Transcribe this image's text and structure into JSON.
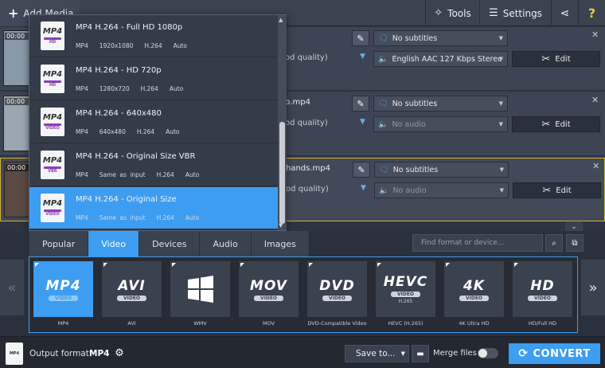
{
  "toolbar": {
    "add_media": "Add Media",
    "tools": "Tools",
    "settings": "Settings",
    "help": "?"
  },
  "files": [
    {
      "time": "00:00",
      "name": "",
      "quality": "od quality)",
      "subtitles": "No subtitles",
      "audio": "English AAC 127 Kbps Stereo",
      "audio_dim": false,
      "edit": "Edit"
    },
    {
      "time": "00:00",
      "name": "p.mp4",
      "quality": "od quality)",
      "subtitles": "No subtitles",
      "audio": "No audio",
      "audio_dim": true,
      "edit": "Edit"
    },
    {
      "time": "00:00",
      "name": "hands.mp4",
      "quality": "od quality)",
      "subtitles": "No subtitles",
      "audio": "No audio",
      "audio_dim": true,
      "edit": "Edit"
    }
  ],
  "dropdown": {
    "items": [
      {
        "title": "MP4 H.264 - Full HD 1080p",
        "container": "MP4",
        "size": "1920x1080",
        "codec": "H.264",
        "bitrate": "Auto",
        "tag": "HD"
      },
      {
        "title": "MP4 H.264 - HD 720p",
        "container": "MP4",
        "size": "1280x720",
        "codec": "H.264",
        "bitrate": "Auto",
        "tag": "HD"
      },
      {
        "title": "MP4 H.264 - 640x480",
        "container": "MP4",
        "size": "640x480",
        "codec": "H.264",
        "bitrate": "Auto",
        "tag": "VIDEO"
      },
      {
        "title": "MP4 H.264 - Original Size VBR",
        "container": "MP4",
        "size": "Same as input",
        "codec": "H.264",
        "bitrate": "Auto",
        "tag": "VBR"
      },
      {
        "title": "MP4 H.264 - Original Size",
        "container": "MP4",
        "size": "Same as input",
        "codec": "H.264",
        "bitrate": "Auto",
        "tag": "VIDEO"
      }
    ],
    "active_index": 4,
    "icon_label": "MP4"
  },
  "tabs": [
    "Popular",
    "Video",
    "Devices",
    "Audio",
    "Images"
  ],
  "active_tab": 1,
  "search": {
    "placeholder": "Find format or device..."
  },
  "formats": [
    {
      "big": "MP4",
      "sub": "VIDEO",
      "ext": "",
      "label": "MP4"
    },
    {
      "big": "AVI",
      "sub": "VIDEO",
      "ext": "",
      "label": "AVI"
    },
    {
      "big": "",
      "sub": "",
      "ext": "",
      "label": "WMV"
    },
    {
      "big": "MOV",
      "sub": "VIDEO",
      "ext": "",
      "label": "MOV"
    },
    {
      "big": "DVD",
      "sub": "VIDEO",
      "ext": "",
      "label": "DVD-Compatible Video"
    },
    {
      "big": "HEVC",
      "sub": "VIDEO",
      "ext": "H.265",
      "label": "HEVC (H.265)"
    },
    {
      "big": "4K",
      "sub": "VIDEO",
      "ext": "",
      "label": "4K Ultra HD"
    },
    {
      "big": "HD",
      "sub": "VIDEO",
      "ext": "",
      "label": "HD/Full HD"
    }
  ],
  "active_format": 0,
  "bottom": {
    "output_label": "Output format:",
    "output_value": "MP4",
    "output_icon": "MP4",
    "save_to": "Save to...",
    "merge_label": "Merge files:",
    "merge_on": false,
    "convert": "CONVERT"
  },
  "colors": {
    "accent": "#3d9df0",
    "selected_border": "#d9b230",
    "help": "#f2c744"
  }
}
